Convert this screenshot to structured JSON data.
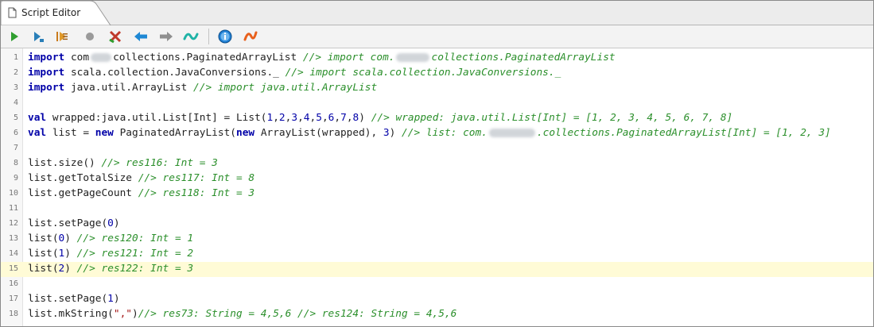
{
  "tab": {
    "title": "Script Editor"
  },
  "toolbar": {
    "buttons": [
      {
        "name": "run-button",
        "icon": "play-icon",
        "color": "#2f9e2f"
      },
      {
        "name": "step-button",
        "icon": "step-run-icon",
        "color": "#2a7fb8"
      },
      {
        "name": "run-to-cursor-button",
        "icon": "run-lines-icon",
        "color": "#c97a1c"
      },
      {
        "name": "stop-button",
        "icon": "record-stop-icon",
        "color": "#9a9a9a"
      },
      {
        "name": "clear-button",
        "icon": "clear-icon",
        "color": "#c0392b"
      },
      {
        "name": "back-button",
        "icon": "arrow-left-icon",
        "color": "#1f88d4"
      },
      {
        "name": "forward-button",
        "icon": "arrow-right-icon",
        "color": "#8f8f8f"
      },
      {
        "name": "format-button",
        "icon": "wave-teal-icon",
        "color": "#1fb3a6"
      },
      {
        "name": "info-button",
        "icon": "info-icon",
        "color": "#1f7fd4"
      },
      {
        "name": "scala-button",
        "icon": "wave-orange-icon",
        "color": "#e8601c"
      }
    ]
  },
  "code": {
    "current_line": 15,
    "lines": [
      {
        "n": "1",
        "segs": [
          {
            "t": "import",
            "c": "kw"
          },
          {
            "t": " com"
          },
          {
            "blur": 26
          },
          {
            "t": "collections.PaginatedArrayList "
          },
          {
            "t": "//> import com.",
            "c": "cm"
          },
          {
            "blur": 42
          },
          {
            "t": "collections.PaginatedArrayList",
            "c": "cm"
          }
        ]
      },
      {
        "n": "2",
        "segs": [
          {
            "t": "import",
            "c": "kw"
          },
          {
            "t": " scala.collection.JavaConversions._ "
          },
          {
            "t": "//> import scala.collection.JavaConversions._",
            "c": "cm"
          }
        ]
      },
      {
        "n": "3",
        "segs": [
          {
            "t": "import",
            "c": "kw"
          },
          {
            "t": " java.util.ArrayList "
          },
          {
            "t": "//> import java.util.ArrayList",
            "c": "cm"
          }
        ]
      },
      {
        "n": "4",
        "segs": []
      },
      {
        "n": "5",
        "segs": [
          {
            "t": "val",
            "c": "kw"
          },
          {
            "t": " wrapped:java.util.List[Int] = List("
          },
          {
            "t": "1",
            "c": "num"
          },
          {
            "t": ","
          },
          {
            "t": "2",
            "c": "num"
          },
          {
            "t": ","
          },
          {
            "t": "3",
            "c": "num"
          },
          {
            "t": ","
          },
          {
            "t": "4",
            "c": "num"
          },
          {
            "t": ","
          },
          {
            "t": "5",
            "c": "num"
          },
          {
            "t": ","
          },
          {
            "t": "6",
            "c": "num"
          },
          {
            "t": ","
          },
          {
            "t": "7",
            "c": "num"
          },
          {
            "t": ","
          },
          {
            "t": "8",
            "c": "num"
          },
          {
            "t": ") "
          },
          {
            "t": "//> wrapped: java.util.List[Int] = [1, 2, 3, 4, 5, 6, 7, 8]",
            "c": "cm"
          }
        ]
      },
      {
        "n": "6",
        "segs": [
          {
            "t": "val",
            "c": "kw"
          },
          {
            "t": " list = "
          },
          {
            "t": "new",
            "c": "kw"
          },
          {
            "t": " PaginatedArrayList("
          },
          {
            "t": "new",
            "c": "kw"
          },
          {
            "t": " ArrayList(wrapped), "
          },
          {
            "t": "3",
            "c": "num"
          },
          {
            "t": ") "
          },
          {
            "t": "//> list: com.",
            "c": "cm"
          },
          {
            "blur": 58
          },
          {
            "t": ".collections.PaginatedArrayList[Int] = [1, 2, 3]",
            "c": "cm"
          }
        ]
      },
      {
        "n": "7",
        "segs": []
      },
      {
        "n": "8",
        "segs": [
          {
            "t": "list.size() "
          },
          {
            "t": "//> res116: Int = 3",
            "c": "cm"
          }
        ]
      },
      {
        "n": "9",
        "segs": [
          {
            "t": "list.getTotalSize "
          },
          {
            "t": "//> res117: Int = 8",
            "c": "cm"
          }
        ]
      },
      {
        "n": "10",
        "segs": [
          {
            "t": "list.getPageCount "
          },
          {
            "t": "//> res118: Int = 3",
            "c": "cm"
          }
        ]
      },
      {
        "n": "11",
        "segs": []
      },
      {
        "n": "12",
        "segs": [
          {
            "t": "list.setPage("
          },
          {
            "t": "0",
            "c": "num"
          },
          {
            "t": ")"
          }
        ]
      },
      {
        "n": "13",
        "segs": [
          {
            "t": "list("
          },
          {
            "t": "0",
            "c": "num"
          },
          {
            "t": ") "
          },
          {
            "t": "//> res120: Int = 1",
            "c": "cm"
          }
        ]
      },
      {
        "n": "14",
        "segs": [
          {
            "t": "list("
          },
          {
            "t": "1",
            "c": "num"
          },
          {
            "t": ") "
          },
          {
            "t": "//> res121: Int = 2",
            "c": "cm"
          }
        ]
      },
      {
        "n": "15",
        "segs": [
          {
            "t": "list("
          },
          {
            "t": "2",
            "c": "num"
          },
          {
            "t": ") "
          },
          {
            "t": "//> res122: Int = 3",
            "c": "cm"
          }
        ]
      },
      {
        "n": "16",
        "segs": []
      },
      {
        "n": "17",
        "segs": [
          {
            "t": "list.setPage("
          },
          {
            "t": "1",
            "c": "num"
          },
          {
            "t": ")"
          }
        ]
      },
      {
        "n": "18",
        "segs": [
          {
            "t": "list.mkString("
          },
          {
            "t": "\",\"",
            "c": "str"
          },
          {
            "t": ")"
          },
          {
            "t": "//> res73: String = 4,5,6 //> res124: String = 4,5,6",
            "c": "cm"
          }
        ]
      }
    ]
  }
}
